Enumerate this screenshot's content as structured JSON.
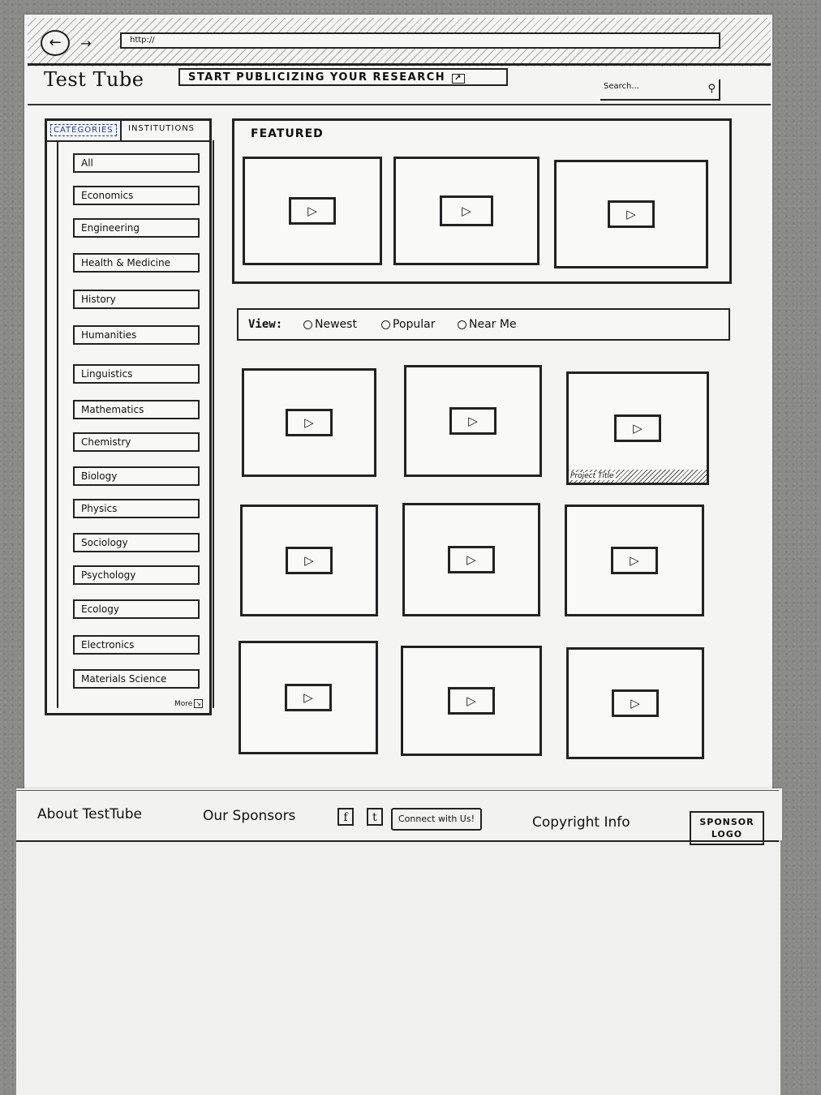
{
  "browser": {
    "url": "http://",
    "back_icon": "back-arrow-icon",
    "forward_icon": "forward-arrow-icon"
  },
  "header": {
    "logo": "Test Tube",
    "cta_label": "START PUBLICIZING YOUR RESEARCH",
    "search_placeholder": "Search..."
  },
  "sidebar": {
    "tabs": [
      "CATEGORIES",
      "INSTITUTIONS"
    ],
    "active_tab": "CATEGORIES",
    "categories": [
      "All",
      "Economics",
      "Engineering",
      "Health & Medicine",
      "History",
      "Humanities",
      "Linguistics",
      "Mathematics",
      "Chemistry",
      "Biology",
      "Physics",
      "Sociology",
      "Psychology",
      "Ecology",
      "Electronics",
      "Materials Science"
    ],
    "more_label": "More"
  },
  "featured": {
    "title": "FEATURED"
  },
  "view": {
    "label": "View:",
    "options": [
      "Newest",
      "Popular",
      "Near Me"
    ]
  },
  "grid": {
    "caption": "Project Title"
  },
  "footer": {
    "about": "About TestTube",
    "sponsors": "Our Sponsors",
    "facebook": "f",
    "twitter": "t",
    "connect": "Connect with Us!",
    "copyright": "Copyright Info",
    "sponsor_logo_line1": "SPONSOR",
    "sponsor_logo_line2": "LOGO"
  },
  "colors": {
    "ink": "#222222",
    "paper": "#f4f4f2",
    "background": "#8a8a86",
    "tab_highlight": "#1c3a9a"
  }
}
